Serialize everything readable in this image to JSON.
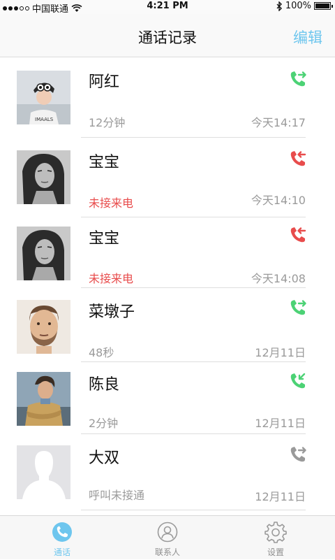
{
  "status_bar": {
    "carrier": "中国联通",
    "time": "4:21 PM",
    "battery": "100%"
  },
  "header": {
    "title": "通话记录",
    "edit_label": "编辑"
  },
  "calls": [
    {
      "name": "阿红",
      "detail": "12分钟",
      "time": "今天14:17",
      "type": "outgoing",
      "missed": false
    },
    {
      "name": "宝宝",
      "detail": "未接来电",
      "time": "今天14:10",
      "type": "missed",
      "missed": true
    },
    {
      "name": "宝宝",
      "detail": "未接来电",
      "time": "今天14:08",
      "type": "missed",
      "missed": true
    },
    {
      "name": "菜墩子",
      "detail": "48秒",
      "time": "12月11日",
      "type": "outgoing",
      "missed": false
    },
    {
      "name": "陈良",
      "detail": "2分钟",
      "time": "12月11日",
      "type": "incoming",
      "missed": false
    },
    {
      "name": "大双",
      "detail": "呼叫未接通",
      "time": "12月11日",
      "type": "unanswered",
      "missed": false
    }
  ],
  "tabs": [
    {
      "label": "通话",
      "icon": "phone-icon",
      "active": true
    },
    {
      "label": "联系人",
      "icon": "contacts-icon",
      "active": false
    },
    {
      "label": "设置",
      "icon": "settings-icon",
      "active": false
    }
  ],
  "colors": {
    "accent": "#6ec6ee",
    "call_green": "#4cd275",
    "missed_red": "#e84c4c",
    "unanswered_gray": "#9a9a9a"
  }
}
